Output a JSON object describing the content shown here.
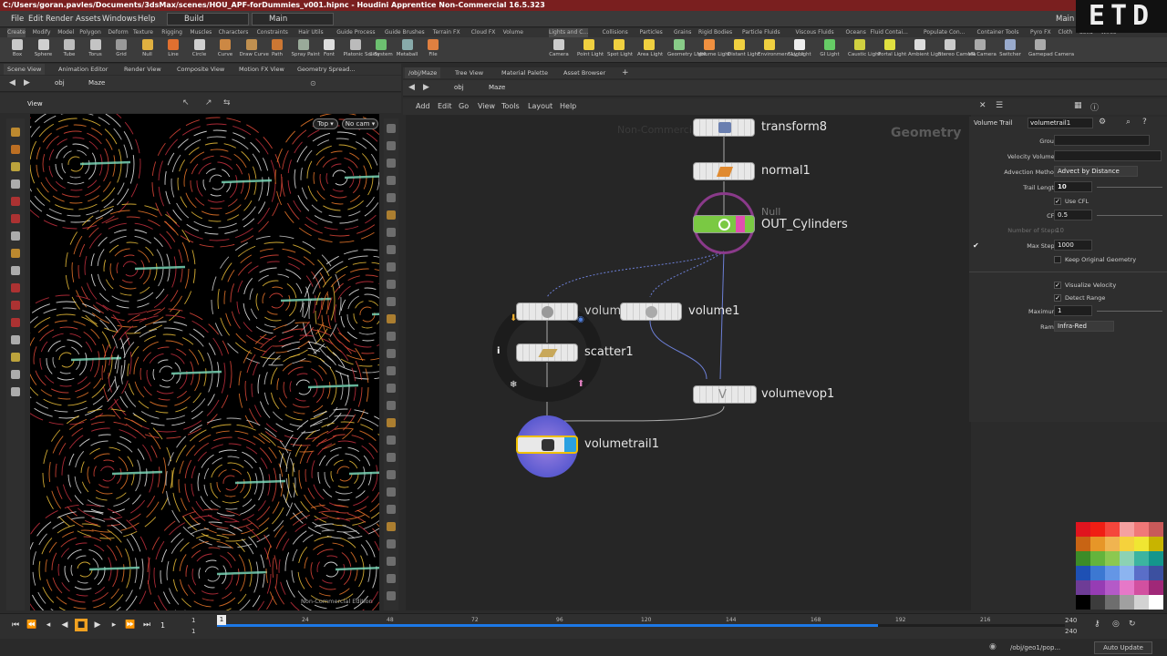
{
  "window": {
    "title": "C:/Users/goran.pavles/Documents/3dsMax/scenes/HOU_APF-forDummies_v001.hipnc - Houdini Apprentice Non-Commercial 16.5.323"
  },
  "menu": {
    "items": [
      "File",
      "Edit",
      "Render",
      "Assets",
      "Windows",
      "Help"
    ],
    "build": "Build",
    "desktop": "Main",
    "desktop_right": "Main"
  },
  "shelf_tabs_left": [
    "Create",
    "Modify",
    "Model",
    "Polygon",
    "Deform",
    "Texture",
    "Rigging",
    "Muscles",
    "Characters",
    "Constraints",
    "Hair Utils",
    "Guide Process",
    "Guide Brushes",
    "Terrain FX",
    "Cloud FX",
    "Volume"
  ],
  "shelf_tabs_right": [
    "Lights and C...",
    "Collisions",
    "Particles",
    "Grains",
    "Rigid Bodies",
    "Particle Fluids",
    "Viscous Fluids",
    "Oceans",
    "Fluid Contai...",
    "Populate Con...",
    "Container Tools",
    "Pyro FX",
    "Cloth",
    "Solid",
    "Wires"
  ],
  "tools_left": [
    "Box",
    "Sphere",
    "Tube",
    "Torus",
    "Grid",
    "Null",
    "Line",
    "Circle",
    "Curve",
    "Draw Curve",
    "Path",
    "Spray Paint",
    "Font",
    "Platonic Solids",
    "L-System",
    "Metaball",
    "File"
  ],
  "tools_right": [
    "Camera",
    "Point Light",
    "Spot Light",
    "Area Light",
    "Geometry Light",
    "Volume Light",
    "Distant Light",
    "Environment Light",
    "Sky Light",
    "GI Light",
    "Caustic Light",
    "Portal Light",
    "Ambient Light",
    "Stereo Camera",
    "VR Camera",
    "Switcher",
    "Gamepad Camera"
  ],
  "logo": "ETD",
  "left_pane": {
    "tabs": [
      "Scene View",
      "Animation Editor",
      "Render View",
      "Composite View",
      "Motion FX View",
      "Geometry Spread..."
    ],
    "path": [
      "obj",
      "Maze"
    ],
    "view_label": "View",
    "top_button": "Top",
    "cam_button": "No cam",
    "watermark": "Non-Commercial Edition"
  },
  "right_pane": {
    "tabs": [
      "/obj/Maze",
      "Tree View",
      "Material Palette",
      "Asset Browser"
    ],
    "path": [
      "obj",
      "Maze"
    ],
    "menu": [
      "Add",
      "Edit",
      "Go",
      "View",
      "Tools",
      "Layout",
      "Help"
    ],
    "watermark": "Non-Commercial",
    "context": "Geometry"
  },
  "nodes": {
    "transform": "transform8",
    "normal": "normal1",
    "null_type": "Null",
    "out": "OUT_Cylinders",
    "volume2": "volume2",
    "volume1": "volume1",
    "scatter": "scatter1",
    "volumevop": "volumevop1",
    "volumetrail": "volumetrail1"
  },
  "params": {
    "node_type": "Volume Trail",
    "node_name": "volumetrail1",
    "group_label": "Group",
    "velocity_volumes_label": "Velocity Volumes",
    "advection_label": "Advection Method",
    "advection_value": "Advect by Distance",
    "trail_length_label": "Trail Length",
    "trail_length": "10",
    "use_cfl": "Use CFL",
    "cfl_label": "CFL",
    "cfl": "0.5",
    "num_steps_label": "Number of Steps",
    "num_steps": "10",
    "max_steps_label": "Max Steps",
    "max_steps": "1000",
    "keep_original": "Keep Original Geometry",
    "visualize_velocity": "Visualize Velocity",
    "detect_range": "Detect Range",
    "maximum_label": "Maximum",
    "maximum": "1",
    "ramp_label": "Ramp",
    "ramp_value": "Infra-Red"
  },
  "palette": [
    "#e0141e",
    "#f01e14",
    "#f5463c",
    "#f5a0a0",
    "#f07878",
    "#c85a5a",
    "#c86414",
    "#e69628",
    "#f0b450",
    "#f5d23c",
    "#f0e632",
    "#c8b400",
    "#3c8c28",
    "#64b43c",
    "#8cc850",
    "#8cd2b4",
    "#3cb4a0",
    "#14968c",
    "#1e50b4",
    "#3c78d2",
    "#6496e6",
    "#8cb4f0",
    "#5a6ec8",
    "#3c50a0",
    "#6e3c96",
    "#963cb4",
    "#b45ac8",
    "#e678c8",
    "#d250a0",
    "#a02878",
    "#000000",
    "#3c3c3c",
    "#6e6e6e",
    "#a0a0a0",
    "#d2d2d2",
    "#ffffff"
  ],
  "timeline": {
    "current_frame": "1",
    "start_top": "1",
    "start_bottom": "1",
    "ticks": [
      "24",
      "48",
      "72",
      "96",
      "120",
      "144",
      "168",
      "192",
      "216"
    ],
    "end_top": "240",
    "end_bottom": "240",
    "cache_fraction": 0.78
  },
  "status": {
    "path": "/obj/geo1/pop...",
    "auto_update": "Auto Update"
  }
}
